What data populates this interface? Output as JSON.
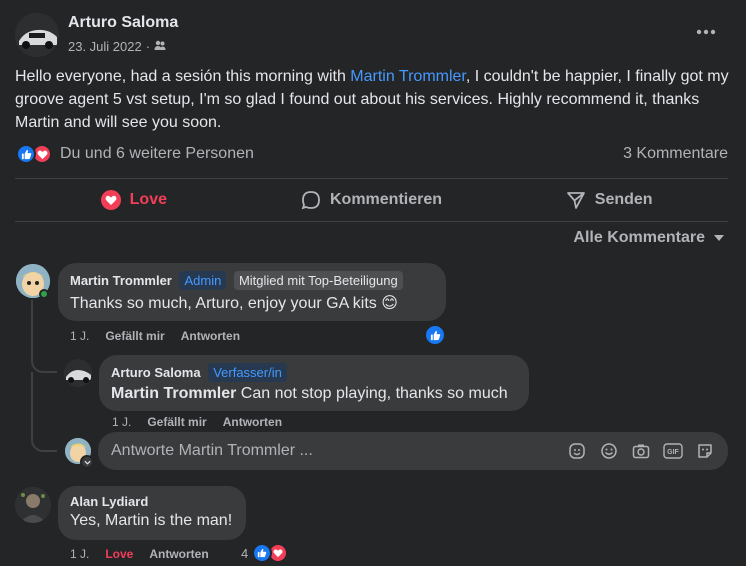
{
  "post": {
    "author": "Arturo Saloma",
    "date": "23. Juli 2022",
    "separator": "·",
    "text_before": "Hello everyone, had a sesión this morning with ",
    "mention": "Martin Trommler",
    "text_after": ", I couldn't be happier, I finally got my groove agent 5 vst setup, I'm so glad I found out about his services. Highly recommend it, thanks Martin and will see you soon.",
    "reactions_text": "Du und 6 weitere Personen",
    "comment_count": "3 Kommentare"
  },
  "actions": {
    "love": "Love",
    "comment": "Kommentieren",
    "send": "Senden"
  },
  "sort_label": "Alle Kommentare",
  "comments": [
    {
      "name": "Martin Trommler",
      "badge1": "Admin",
      "badge2": "Mitglied mit Top-Beteiligung",
      "text": "Thanks so much, Arturo, enjoy your GA kits 😊",
      "time": "1 J.",
      "like": "Gefällt mir",
      "reply": "Antworten"
    },
    {
      "name": "Arturo Saloma",
      "badge1": "Verfasser/in",
      "mention": "Martin Trommler",
      "text": " Can not stop playing, thanks so much",
      "time": "1 J.",
      "like": "Gefällt mir",
      "reply": "Antworten"
    },
    {
      "name": "Alan Lydiard",
      "text": "Yes, Martin is the man!",
      "time": "1 J.",
      "like": "Love",
      "reply": "Antworten",
      "reaction_count": "4"
    }
  ],
  "reply_input": {
    "placeholder": "Antworte Martin Trommler ..."
  },
  "colors": {
    "background": "#242526",
    "bubble": "#3a3b3c",
    "link": "#4599ff",
    "love": "#f33e58",
    "like": "#1877f2"
  }
}
